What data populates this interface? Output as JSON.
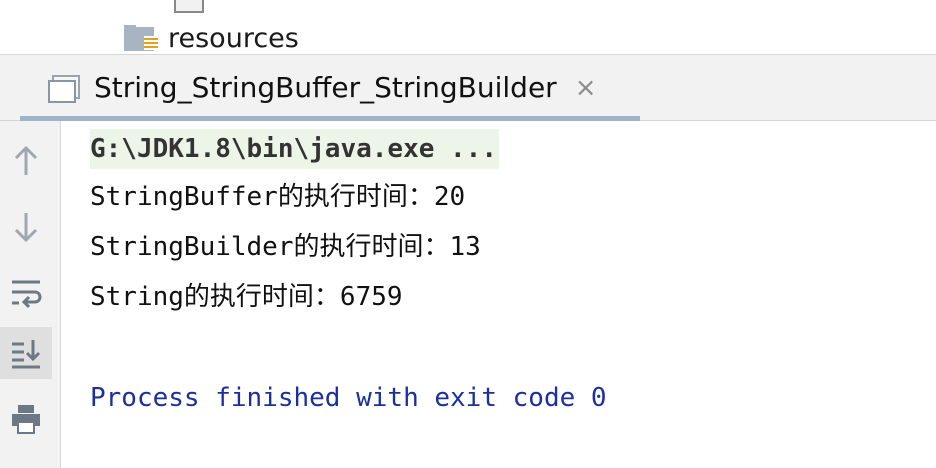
{
  "project_tree": {
    "folder_label": "resources"
  },
  "run_panel": {
    "tab_title": "String_StringBuffer_StringBuilder",
    "close_glyph": "×"
  },
  "toolbar": {
    "buttons": [
      {
        "icon": "arrow-up-icon"
      },
      {
        "icon": "arrow-down-icon"
      },
      {
        "icon": "soft-wrap-icon"
      },
      {
        "icon": "scroll-to-end-icon",
        "active": true
      },
      {
        "icon": "print-icon"
      }
    ]
  },
  "console": {
    "command": "G:\\JDK1.8\\bin\\java.exe ...",
    "output": [
      "StringBuffer的执行时间：20",
      "StringBuilder的执行时间：13",
      "String的执行时间：6759"
    ],
    "exit_message": "Process finished with exit code 0"
  },
  "colors": {
    "command_highlight": "#ecf5e8",
    "exit_text": "#1d2fa0",
    "tab_underline": "#9fb3cb"
  }
}
